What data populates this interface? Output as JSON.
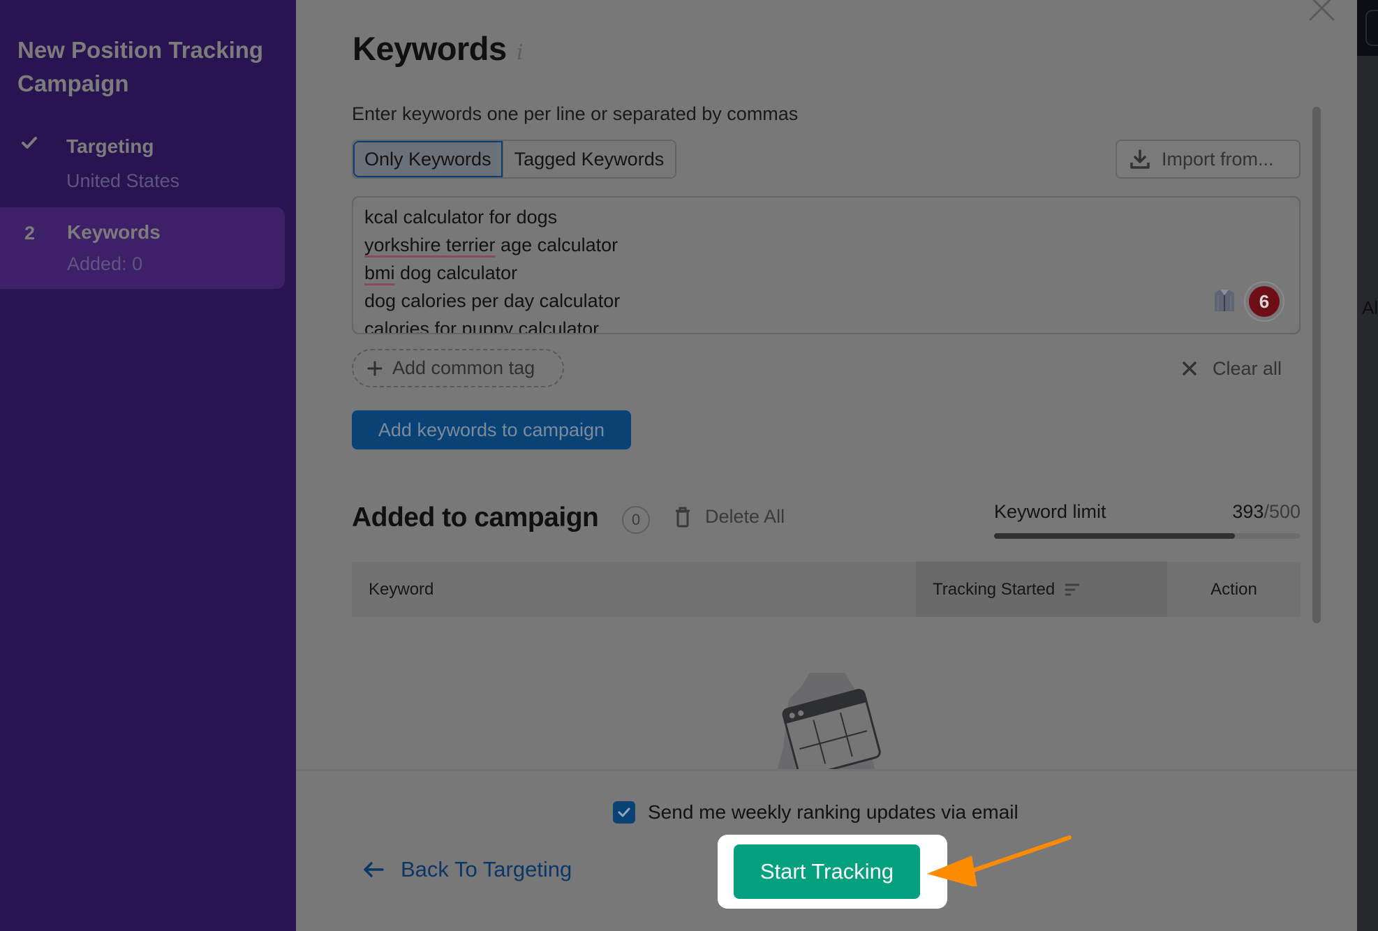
{
  "sidebar": {
    "title": "New Position Tracking Campaign",
    "steps": [
      {
        "marker": "✓",
        "marker_icon": "check-icon",
        "label": "Targeting",
        "sub": "United States",
        "state": "completed"
      },
      {
        "marker": "2",
        "label": "Keywords",
        "sub": "Added: 0",
        "state": "active"
      }
    ]
  },
  "modal": {
    "title": "Keywords",
    "info_icon": "i",
    "instruction": "Enter keywords one per line or separated by commas",
    "tabs": [
      {
        "label": "Only Keywords",
        "active": true
      },
      {
        "label": "Tagged Keywords",
        "active": false
      }
    ],
    "import_button": "Import from...",
    "textarea": {
      "lines": [
        "kcal calculator for dogs",
        "yorkshire terrier age calculator",
        "bmi dog calculator",
        "dog calories per day calculator",
        "calories for puppy calculator"
      ],
      "misspelled": [
        "yorkshire terrier",
        "bmi"
      ],
      "extension_badge_count": "6"
    },
    "add_common_tag": "Add common tag",
    "clear_all": "Clear all",
    "add_keywords_button": "Add keywords to campaign",
    "added_section": {
      "title": "Added to campaign",
      "count": "0",
      "delete_all": "Delete All",
      "keyword_limit_label": "Keyword limit",
      "keyword_limit_used": "393",
      "keyword_limit_max": "/500",
      "keyword_limit_fraction": 0.786
    },
    "table": {
      "columns": [
        "Keyword",
        "Tracking Started",
        "Action"
      ]
    },
    "footer": {
      "email_checkbox_label": "Send me weekly ranking updates via email",
      "email_checked": true,
      "back_link": "Back To Targeting",
      "start_button": "Start Tracking"
    }
  },
  "background_pane": {
    "partial_text": "Al"
  },
  "colors": {
    "sidebar_bg": "#281450",
    "primary_blue": "#0a4275",
    "start_green": "#05a17f",
    "annotation_arrow": "#ff8c00",
    "badge_red": "#6e0e16"
  }
}
